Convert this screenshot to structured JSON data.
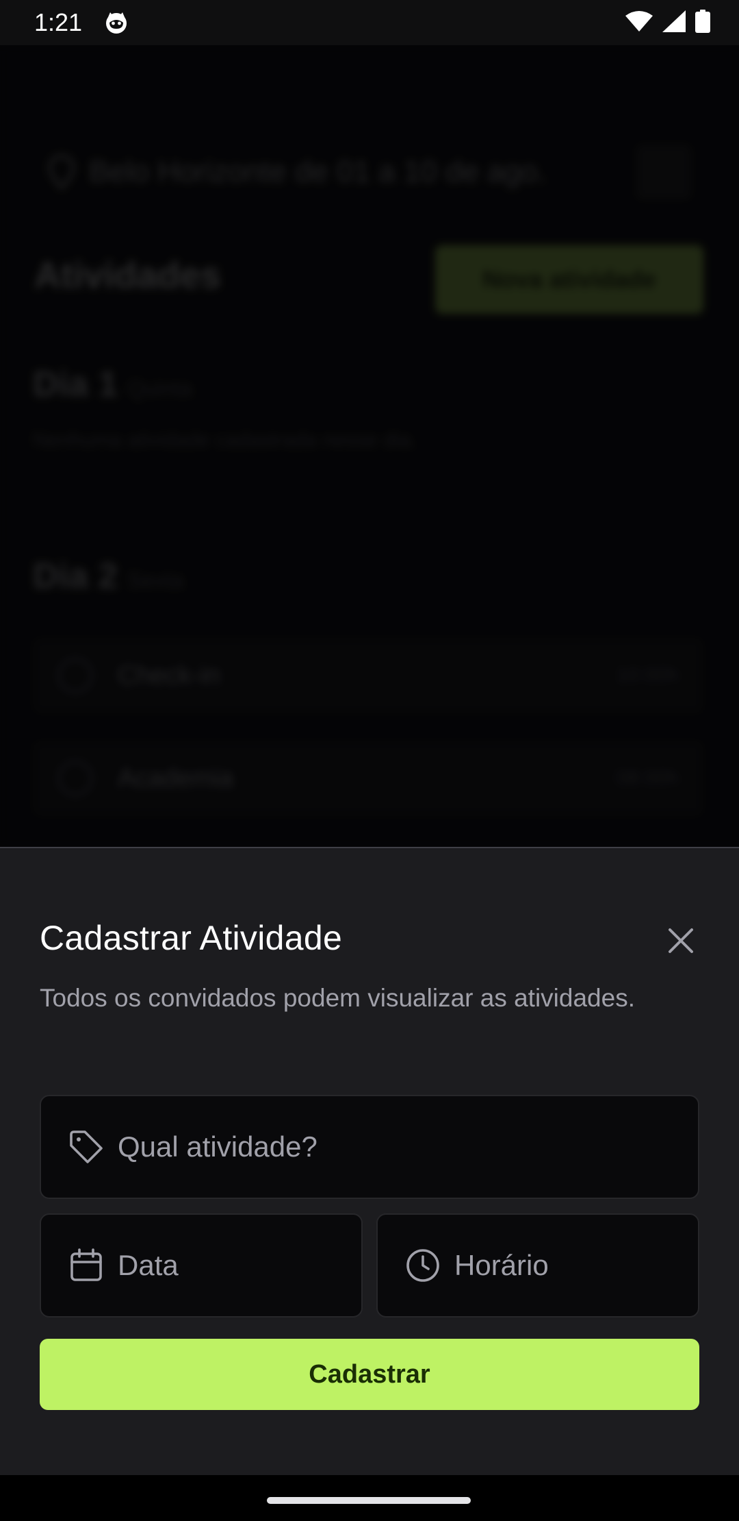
{
  "status_bar": {
    "time": "1:21",
    "icons": [
      "cat-notification-icon",
      "wifi-icon",
      "signal-icon",
      "battery-icon"
    ]
  },
  "background": {
    "trip_summary": "Belo Horizonte de 01 a 10 de ago.",
    "section_title": "Atividades",
    "new_activity_button": "Nova atividade",
    "days": [
      {
        "label": "Dia 1",
        "weekday": "Quinta",
        "empty_text": "Nenhuma atividade cadastrada nesse dia."
      },
      {
        "label": "Dia 2",
        "weekday": "Sexta",
        "activities": [
          {
            "name": "Check-in",
            "time": "10:00h"
          },
          {
            "name": "Academia",
            "time": "08:00h"
          }
        ]
      }
    ]
  },
  "sheet": {
    "title": "Cadastrar Atividade",
    "description": "Todos os convidados podem visualizar as atividades.",
    "activity_placeholder": "Qual atividade?",
    "date_placeholder": "Data",
    "time_placeholder": "Horário",
    "submit_label": "Cadastrar"
  },
  "colors": {
    "accent": "#bef264",
    "sheet_bg": "#1c1c1f",
    "field_bg": "#09090b",
    "muted_text": "#a1a1aa"
  }
}
